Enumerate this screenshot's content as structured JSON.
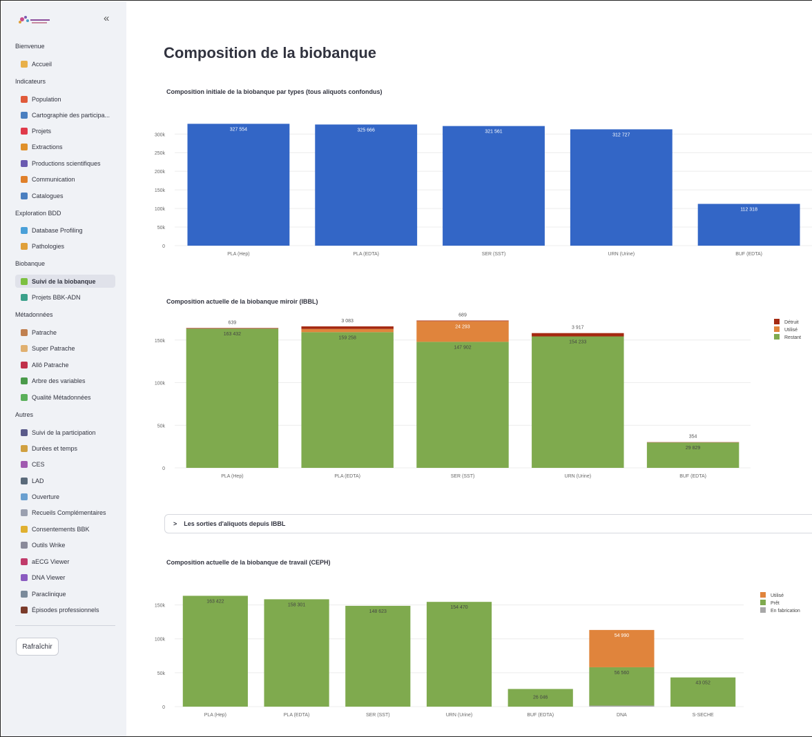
{
  "sidebar": {
    "collapse_icon": "«",
    "refresh_label": "Rafraîchir",
    "sections": [
      {
        "title": "Bienvenue",
        "items": [
          {
            "label": "Accueil",
            "icon": "house-icon",
            "color": "#e8b04a"
          }
        ]
      },
      {
        "title": "Indicateurs",
        "items": [
          {
            "label": "Population",
            "icon": "table-icon",
            "color": "#e05a3a"
          },
          {
            "label": "Cartographie des participa...",
            "icon": "map-icon",
            "color": "#4a7fc0"
          },
          {
            "label": "Projets",
            "icon": "pin-icon",
            "color": "#e03a4a"
          },
          {
            "label": "Extractions",
            "icon": "truck-icon",
            "color": "#e0902a"
          },
          {
            "label": "Productions scientifiques",
            "icon": "books-icon",
            "color": "#6a5ab0"
          },
          {
            "label": "Communication",
            "icon": "megaphone-icon",
            "color": "#e0802a"
          },
          {
            "label": "Catalogues",
            "icon": "magnifier-icon",
            "color": "#4a7fc0"
          }
        ]
      },
      {
        "title": "Exploration BDD",
        "items": [
          {
            "label": "Database Profiling",
            "icon": "cube-icon",
            "color": "#4aa0d8"
          },
          {
            "label": "Pathologies",
            "icon": "virus-icon",
            "color": "#e0a03a"
          }
        ]
      },
      {
        "title": "Biobanque",
        "items": [
          {
            "label": "Suivi de la biobanque",
            "icon": "pipette-icon",
            "color": "#7cc040",
            "active": true
          },
          {
            "label": "Projets BBK-ADN",
            "icon": "dna-icon",
            "color": "#3aa08a"
          }
        ]
      },
      {
        "title": "Métadonnées",
        "items": [
          {
            "label": "Patrache",
            "icon": "dog-icon",
            "color": "#c08050"
          },
          {
            "label": "Super Patrache",
            "icon": "dog2-icon",
            "color": "#e0b070"
          },
          {
            "label": "Allô Patrache",
            "icon": "phone-icon",
            "color": "#c0304a"
          },
          {
            "label": "Arbre des variables",
            "icon": "tree-icon",
            "color": "#4a9a4a"
          },
          {
            "label": "Qualité Métadonnées",
            "icon": "check-icon",
            "color": "#5ab05a"
          }
        ]
      },
      {
        "title": "Autres",
        "items": [
          {
            "label": "Suivi de la participation",
            "icon": "people-icon",
            "color": "#5a5a8a"
          },
          {
            "label": "Durées et temps",
            "icon": "hourglass-icon",
            "color": "#d0a040"
          },
          {
            "label": "CES",
            "icon": "building-icon",
            "color": "#a05ab0"
          },
          {
            "label": "LAD",
            "icon": "car-icon",
            "color": "#5a6a7a"
          },
          {
            "label": "Ouverture",
            "icon": "window-icon",
            "color": "#6aa0d0"
          },
          {
            "label": "Recueils Complémentaires",
            "icon": "syringe-icon",
            "color": "#9aa0b0"
          },
          {
            "label": "Consentements BBK",
            "icon": "medal-icon",
            "color": "#e0b030"
          },
          {
            "label": "Outils Wrike",
            "icon": "tools-icon",
            "color": "#8a8a9a"
          },
          {
            "label": "aECG Viewer",
            "icon": "heart-icon",
            "color": "#c03a6a"
          },
          {
            "label": "DNA Viewer",
            "icon": "dna-viewer-icon",
            "color": "#8a5ac0"
          },
          {
            "label": "Paraclinique",
            "icon": "ruler-icon",
            "color": "#7a8a9a"
          },
          {
            "label": "Épisodes professionnels",
            "icon": "briefcase-icon",
            "color": "#7a3a2a"
          }
        ]
      }
    ]
  },
  "main": {
    "title": "Composition de la biobanque",
    "expander_label": "Les sorties d'aliquots depuis IBBL",
    "expander_icon": "chevron-right-icon"
  },
  "colors": {
    "blue": "#3366c6",
    "green": "#7faa4e",
    "orange": "#e0843c",
    "red": "#a52a12",
    "grey": "#a8a8a8"
  },
  "chart_data": [
    {
      "type": "bar",
      "title": "Composition initiale de la biobanque par types (tous aliquots confondus)",
      "categories": [
        "PLA (Hep)",
        "PLA (EDTA)",
        "SER (SST)",
        "URN (Urine)",
        "BUF (EDTA)"
      ],
      "values": [
        327554,
        325666,
        321561,
        312727,
        112318
      ],
      "value_labels": [
        "327 554",
        "325 666",
        "321 561",
        "312 727",
        "112 318"
      ],
      "yticks": [
        0,
        50000,
        100000,
        150000,
        200000,
        250000,
        300000
      ],
      "ytick_labels": [
        "0",
        "50k",
        "100k",
        "150k",
        "200k",
        "250k",
        "300k"
      ],
      "ylim": [
        0,
        345000
      ],
      "grid": true
    },
    {
      "type": "bar",
      "stacked": true,
      "title": "Composition actuelle de la biobanque miroir (IBBL)",
      "categories": [
        "PLA (Hep)",
        "PLA (EDTA)",
        "SER (SST)",
        "URN (Urine)",
        "BUF (EDTA)"
      ],
      "series": [
        {
          "name": "Restant",
          "color": "green",
          "values": [
            163432,
            159258,
            147902,
            154233,
            29829
          ],
          "labels": [
            "163 432",
            "159 258",
            "147 902",
            "154 233",
            "29 829"
          ]
        },
        {
          "name": "Utilisé",
          "color": "orange",
          "values": [
            0,
            3700,
            24293,
            0,
            0
          ],
          "labels": [
            "",
            "",
            "24 293",
            "",
            ""
          ]
        },
        {
          "name": "Détruit",
          "color": "red",
          "values": [
            639,
            3083,
            689,
            3917,
            354
          ],
          "labels": [
            "639",
            "3 083",
            "689",
            "3 917",
            "354"
          ]
        }
      ],
      "legend": [
        "Détruit",
        "Utilisé",
        "Restant"
      ],
      "yticks": [
        0,
        50000,
        100000,
        150000
      ],
      "ytick_labels": [
        "0",
        "50k",
        "100k",
        "150k"
      ],
      "ylim": [
        0,
        183000
      ],
      "legend_position": "top-right",
      "grid": true
    },
    {
      "type": "bar",
      "stacked": true,
      "title": "Composition actuelle de la biobanque de travail (CEPH)",
      "categories": [
        "PLA (Hep)",
        "PLA (EDTA)",
        "SER (SST)",
        "URN (Urine)",
        "BUF (EDTA)",
        "DNA",
        "S-SECHE"
      ],
      "series": [
        {
          "name": "En fabrication",
          "color": "grey",
          "values": [
            0,
            0,
            0,
            0,
            0,
            1500,
            0
          ],
          "labels": [
            "",
            "",
            "",
            "",
            "",
            "",
            ""
          ]
        },
        {
          "name": "Prêt",
          "color": "green",
          "values": [
            163422,
            158301,
            148623,
            154470,
            26046,
            56560,
            43052
          ],
          "labels": [
            "163 422",
            "158 301",
            "148 623",
            "154 470",
            "26 046",
            "56 560",
            "43 052"
          ]
        },
        {
          "name": "Utilisé",
          "color": "orange",
          "values": [
            0,
            0,
            0,
            0,
            0,
            54990,
            0
          ],
          "labels": [
            "",
            "",
            "",
            "",
            "",
            "54 990",
            ""
          ]
        }
      ],
      "legend": [
        "Utilisé",
        "Prêt",
        "En fabrication"
      ],
      "yticks": [
        0,
        50000,
        100000,
        150000
      ],
      "ytick_labels": [
        "0",
        "50k",
        "100k",
        "150k"
      ],
      "ylim": [
        0,
        175000
      ],
      "legend_position": "top-right",
      "grid": true
    }
  ]
}
